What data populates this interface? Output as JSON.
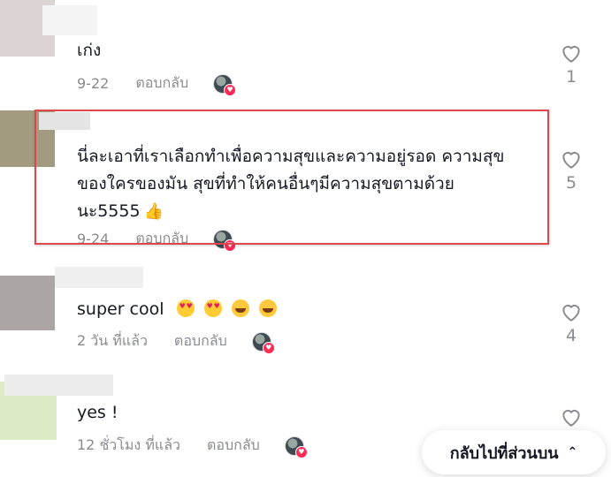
{
  "comments": [
    {
      "text": "เก่ง",
      "date": "9-22",
      "reply": "ตอบกลับ",
      "likes": "1",
      "avatar_color": "#dcd4d2"
    },
    {
      "text_lines": [
        "นี่ละเอาที่เราเลือกทำเพื่อความสุขและความอยู่รอด ความสุข",
        "ของใครของมัน สุขที่ทำให้คนอื่นๆมีความสุขตามด้วย",
        "นะ5555"
      ],
      "date": "9-24",
      "reply": "ตอบกลับ",
      "likes": "5",
      "avatar_color": "#a29b7f",
      "emoji": "thumbs-up"
    },
    {
      "text": "super cool",
      "date": "2 วัน ที่แล้ว",
      "reply": "ตอบกลับ",
      "likes": "4",
      "avatar_color": "#aba5a3",
      "emojis": [
        "heart-eyes",
        "heart-eyes",
        "laughing-tears",
        "laughing-tears"
      ]
    },
    {
      "text": "yes !",
      "date": "12 ชั่วโมง ที่แล้ว",
      "reply": "ตอบกลับ",
      "avatar_color": "#dcebc5"
    }
  ],
  "back_to_top": {
    "label": "กลับไปที่ส่วนบน",
    "icon": "double-chevron-up-icon"
  },
  "colors": {
    "highlight": "#e0474c",
    "creator_heart": "#fe2c55",
    "meta": "#8a8b91"
  }
}
